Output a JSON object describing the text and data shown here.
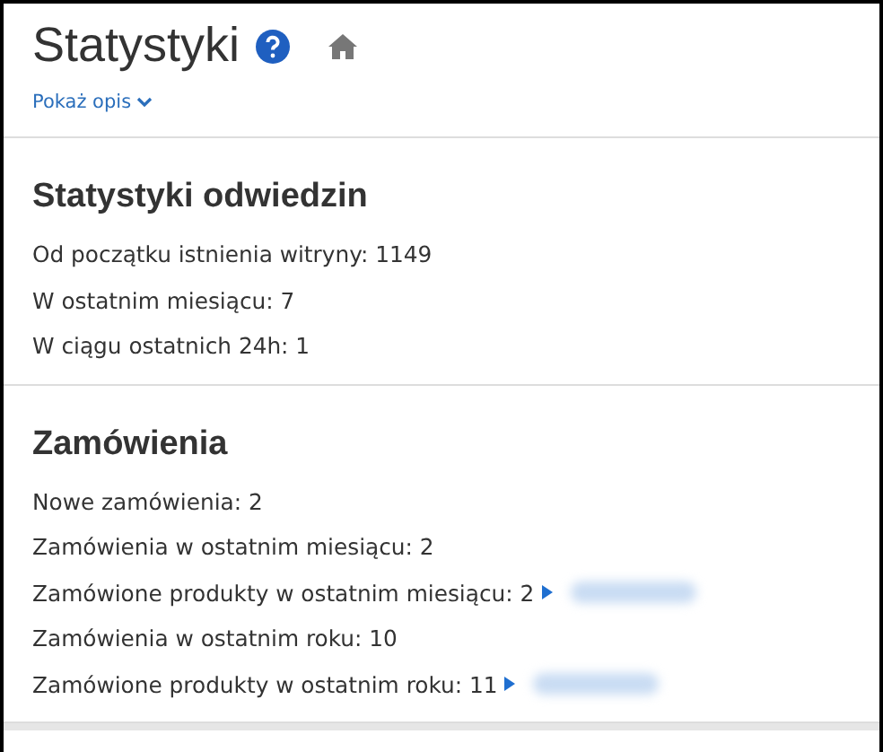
{
  "header": {
    "title": "Statystyki",
    "toggle": "Pokaż opis"
  },
  "sections": [
    {
      "heading": "Statystyki odwiedzin",
      "rows": [
        {
          "text": "Od początku istnienia witryny: 1149",
          "expandable": false
        },
        {
          "text": "W ostatnim miesiącu: 7",
          "expandable": false
        },
        {
          "text": "W ciągu ostatnich 24h: 1",
          "expandable": false
        }
      ]
    },
    {
      "heading": "Zamówienia",
      "rows": [
        {
          "text": "Nowe zamówienia: 2",
          "expandable": false
        },
        {
          "text": "Zamówienia w ostatnim miesiącu: 2",
          "expandable": false
        },
        {
          "text": "Zamówione produkty w ostatnim miesiącu: 2",
          "expandable": true
        },
        {
          "text": "Zamówienia w ostatnim roku: 10",
          "expandable": false
        },
        {
          "text": "Zamówione produkty w ostatnim roku: 11",
          "expandable": true
        }
      ]
    }
  ]
}
